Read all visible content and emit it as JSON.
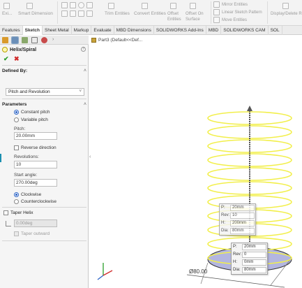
{
  "ribbon": {
    "exit_label": "Exi...",
    "smart_dimension": "Smart Dimension",
    "trim_entities": "Trim Entities",
    "convert_entities": "Convert Entities",
    "offset_entities": "Offset Entities",
    "offset_on_surface": "Offset On Surface",
    "mirror_entities": "Mirror Entities",
    "linear_sketch_pattern": "Linear Sketch Pattern",
    "move_entities": "Move Entities",
    "display_delete": "Display/Delete R..."
  },
  "tabs": [
    "Features",
    "Sketch",
    "Sheet Metal",
    "Markup",
    "Evaluate",
    "MBD Dimensions",
    "SOLIDWORKS Add-Ins",
    "MBD",
    "SOLIDWORKS CAM",
    "SOL"
  ],
  "active_tab": "Sketch",
  "panel": {
    "title": "Helix/Spiral",
    "ok_icon": "check-icon",
    "cancel_icon": "x-icon",
    "defined_by": {
      "header": "Defined By:",
      "selected": "Pitch and Revolution"
    },
    "parameters": {
      "header": "Parameters",
      "constant_pitch": "Constant pitch",
      "variable_pitch": "Variable pitch",
      "pitch_label": "Pitch:",
      "pitch_value": "20.00mm",
      "reverse_direction": "Reverse direction",
      "revolutions_label": "Revolutions:",
      "revolutions_value": "10",
      "start_angle_label": "Start angle:",
      "start_angle_value": "270.00deg",
      "clockwise": "Clockwise",
      "counterclockwise": "Counterclockwise"
    },
    "taper": {
      "header": "Taper Helix",
      "angle_value": "0.00deg",
      "taper_outward": "Taper outward"
    }
  },
  "graphics": {
    "breadcrumb": "Part3 (Default<<Def..."
  },
  "popup_top": {
    "rows": [
      {
        "key": "P:",
        "value": "20mm"
      },
      {
        "key": "Rev:",
        "value": "10"
      },
      {
        "key": "H:",
        "value": "200mm"
      },
      {
        "key": "Dia:",
        "value": "80mm"
      }
    ]
  },
  "popup_bottom": {
    "rows": [
      {
        "key": "P:",
        "value": "20mm"
      },
      {
        "key": "Rev:",
        "value": "0"
      },
      {
        "key": "H:",
        "value": "0mm"
      },
      {
        "key": "Dia:",
        "value": "80mm"
      }
    ]
  },
  "diameter_label": "Ø80.00",
  "colors": {
    "helix": "#f2ef4a",
    "axis": "#555555",
    "base_disc": "#b3b6e0",
    "accent": "#2b63c6"
  }
}
